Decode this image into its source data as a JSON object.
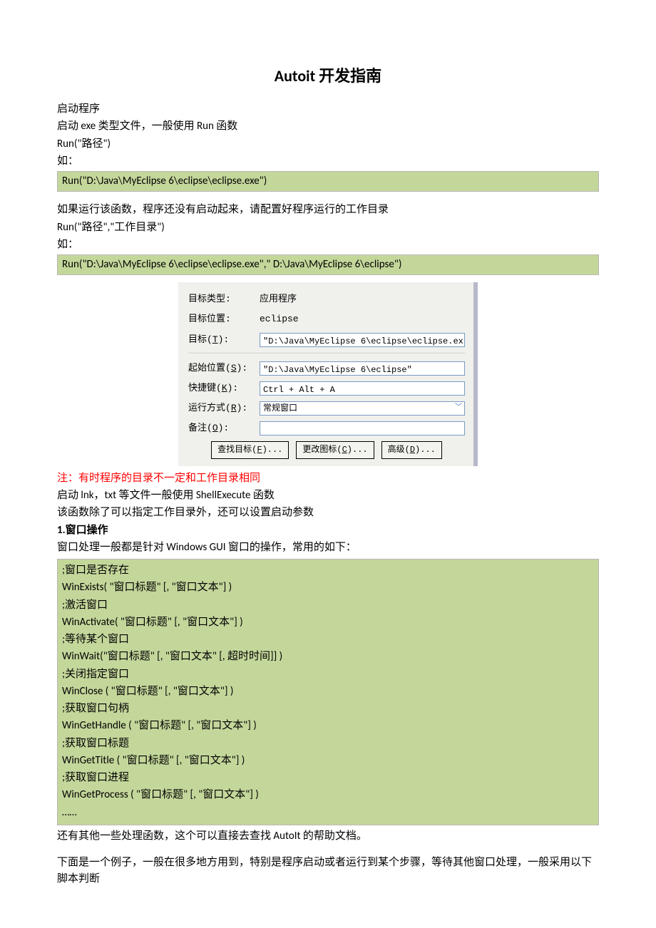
{
  "title": "Autoit 开发指南",
  "intro": {
    "p1": "启动程序",
    "p2": "启动 exe 类型文件，一般使用 Run 函数",
    "p3": "Run(\"路径\")",
    "p4": "如：",
    "code1": "Run(\"D:\\Java\\MyEclipse 6\\eclipse\\eclipse.exe\")",
    "p5": "如果运行该函数，程序还没有启动起来，请配置好程序运行的工作目录",
    "p6": "Run(\"路径\",\"工作目录\")",
    "p7": "如：",
    "code2": "Run(\"D:\\Java\\MyEclipse 6\\eclipse\\eclipse.exe\",\" D:\\Java\\MyEclipse 6\\eclipse\")"
  },
  "props": {
    "type_label": "目标类型:",
    "type_value": "应用程序",
    "loc_label": "目标位置:",
    "loc_value": "eclipse",
    "target_label_pre": "目标(",
    "target_label_key": "T",
    "target_label_post": "):",
    "target_value": "\"D:\\Java\\MyEclipse 6\\eclipse\\eclipse.ex",
    "start_label_pre": "起始位置(",
    "start_label_key": "S",
    "start_label_post": "):",
    "start_value": "\"D:\\Java\\MyEclipse 6\\eclipse\"",
    "shortcut_label_pre": "快捷键(",
    "shortcut_label_key": "K",
    "shortcut_label_post": "):",
    "shortcut_value": "Ctrl + Alt + A",
    "runmode_label_pre": "运行方式(",
    "runmode_label_key": "R",
    "runmode_label_post": "):",
    "runmode_value": "常规窗口",
    "comment_label_pre": "备注(",
    "comment_label_key": "O",
    "comment_label_post": "):",
    "comment_value": "",
    "btn1_pre": "查找目标(",
    "btn1_key": "F",
    "btn1_post": ")...",
    "btn2_pre": "更改图标(",
    "btn2_key": "C",
    "btn2_post": ")...",
    "btn3_pre": "高级(",
    "btn3_key": "D",
    "btn3_post": ")..."
  },
  "after": {
    "note": "注：有时程序的目录不一定和工作目录相同",
    "p1": "启动 lnk，txt 等文件一般使用 ShellExecute 函数",
    "p2": "该函数除了可以指定工作目录外，还可以设置启动参数",
    "sec1": "1.窗口操作",
    "p3": "窗口处理一般都是针对 Windows GUI 窗口的操作，常用的如下：",
    "code_lines": [
      ";窗口是否存在",
      "WinExists( \"窗口标题\" [, \"窗口文本\"] )",
      ";激活窗口",
      "WinActivate( \"窗口标题\" [, \"窗口文本\"] )",
      ";等待某个窗口",
      "WinWait(\"窗口标题\" [, \"窗口文本\" [,  超时时间]] )",
      ";关闭指定窗口",
      "WinClose ( \"窗口标题\" [, \"窗口文本\"] )",
      ";获取窗口句柄",
      "WinGetHandle ( \"窗口标题\" [, \"窗口文本\"] )",
      ";获取窗口标题",
      "WinGetTitle ( \"窗口标题\" [, \"窗口文本\"] )",
      ";获取窗口进程",
      "WinGetProcess    ( \"窗口标题\" [, \"窗口文本\"] )",
      "……"
    ],
    "p4": "还有其他一些处理函数，这个可以直接去查找 AutoIt 的帮助文档。",
    "p5": "下面是一个例子，一般在很多地方用到，特别是程序启动或者运行到某个步骤，等待其他窗口处理，一般采用以下脚本判断"
  }
}
